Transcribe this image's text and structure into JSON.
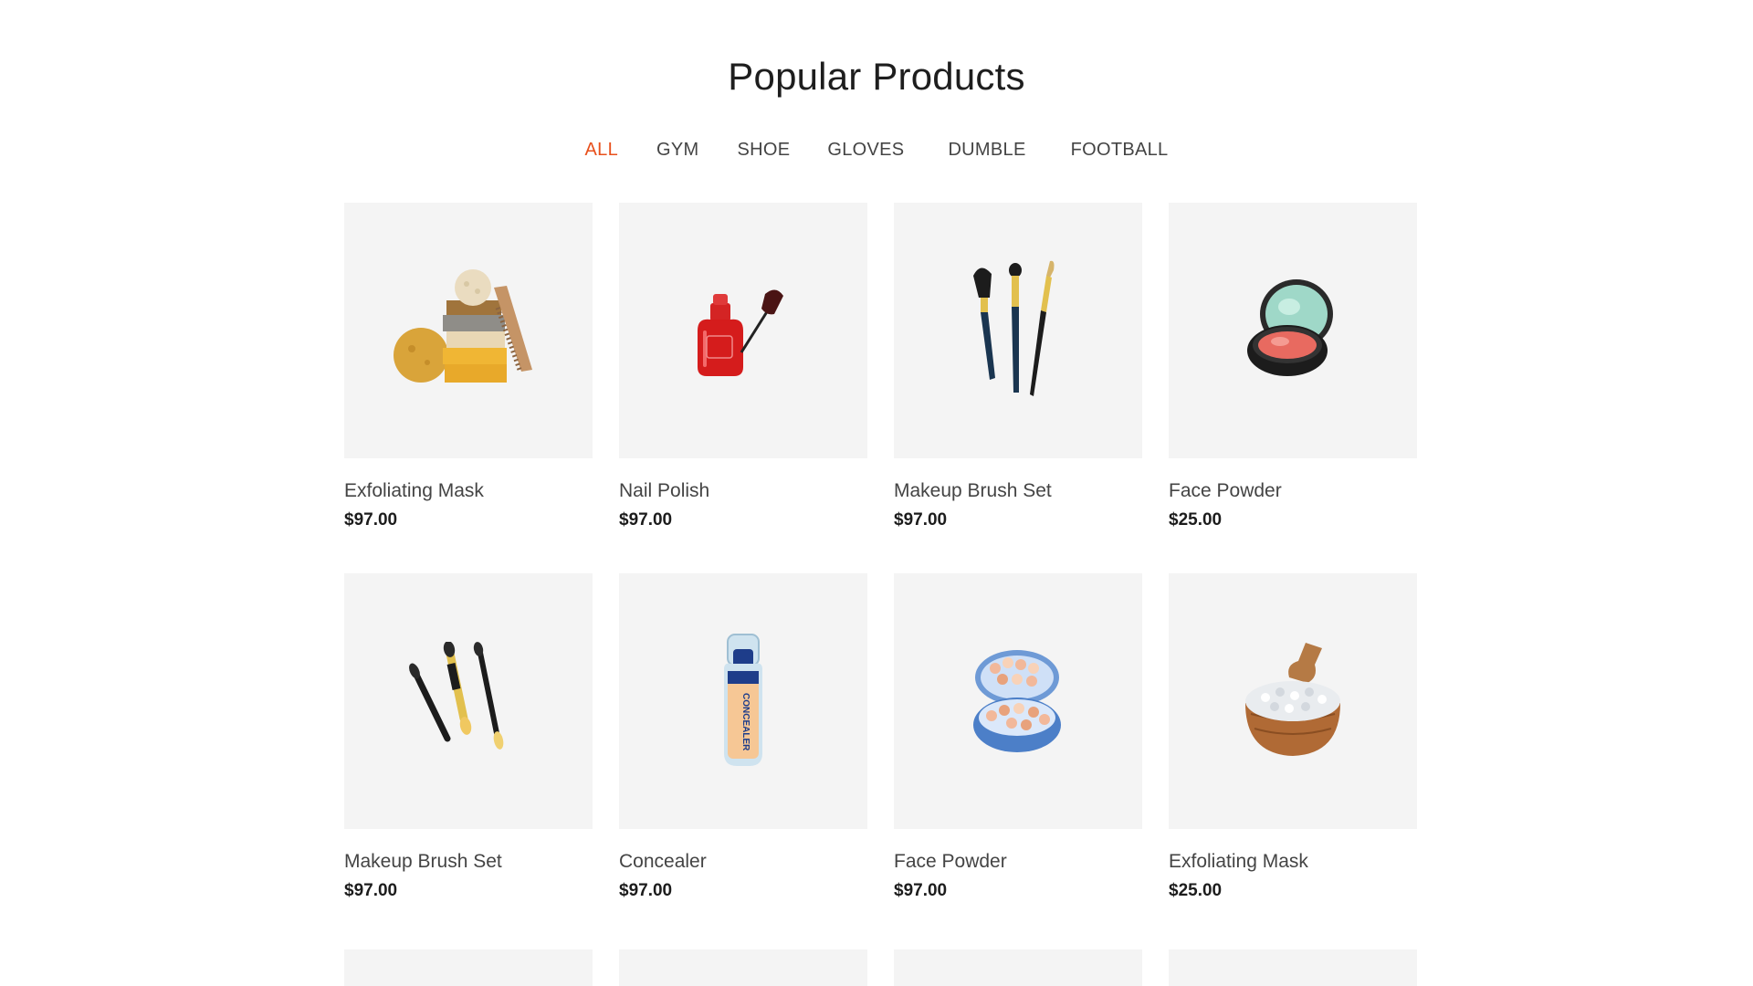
{
  "section": {
    "title": "Popular Products"
  },
  "filters": [
    {
      "label": "ALL",
      "active": true
    },
    {
      "label": "GYM",
      "active": false
    },
    {
      "label": "SHOE",
      "active": false
    },
    {
      "label": "GLOVES",
      "active": false
    },
    {
      "label": "DUMBLE",
      "active": false
    },
    {
      "label": "FOOTBALL",
      "active": false
    }
  ],
  "colors": {
    "accent": "#e8501c",
    "card_bg": "#f4f4f4"
  },
  "products": [
    {
      "name": "Exfoliating Mask",
      "price": "$97.00",
      "icon": "soap-stack-icon"
    },
    {
      "name": "Nail Polish",
      "price": "$97.00",
      "icon": "nail-polish-icon"
    },
    {
      "name": "Makeup Brush Set",
      "price": "$97.00",
      "icon": "makeup-brushes-icon"
    },
    {
      "name": "Face Powder",
      "price": "$25.00",
      "icon": "compact-powder-icon"
    },
    {
      "name": "Makeup Brush Set",
      "price": "$97.00",
      "icon": "eyeshadow-applicators-icon"
    },
    {
      "name": "Concealer",
      "price": "$97.00",
      "icon": "concealer-bottle-icon"
    },
    {
      "name": "Face Powder",
      "price": "$97.00",
      "icon": "powder-pearls-icon"
    },
    {
      "name": "Exfoliating Mask",
      "price": "$25.00",
      "icon": "bath-salt-bowl-icon"
    }
  ]
}
